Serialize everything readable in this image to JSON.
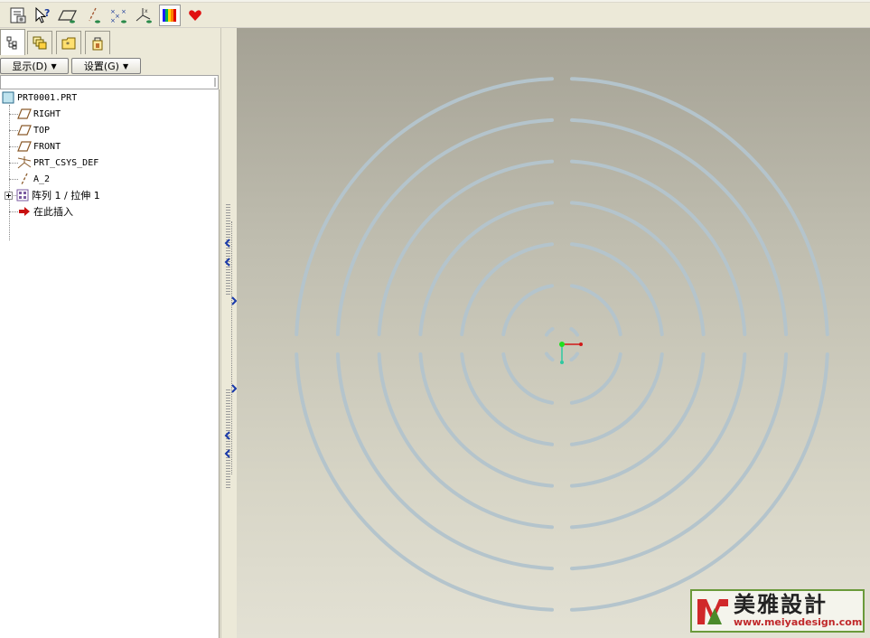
{
  "toolbar": {
    "icons": [
      "regenerate-display-icon",
      "query-select-icon",
      "datum-planes-icon",
      "datum-axes-icon",
      "datum-points-icon",
      "coordinate-systems-icon",
      "color-appearance-icon",
      "favorite-heart-icon"
    ]
  },
  "left_panel": {
    "tabs": [
      "model-tree-tab",
      "layer-tree-tab",
      "folder-browser-tab",
      "connections-tab"
    ],
    "show_menu": "显示(D)",
    "settings_menu": "设置(G)"
  },
  "tree": {
    "root": "PRT0001.PRT",
    "items": [
      {
        "label": "RIGHT",
        "icon": "datum-plane-icon"
      },
      {
        "label": "TOP",
        "icon": "datum-plane-icon"
      },
      {
        "label": "FRONT",
        "icon": "datum-plane-icon"
      },
      {
        "label": "PRT_CSYS_DEF",
        "icon": "coordinate-system-icon"
      },
      {
        "label": "A_2",
        "icon": "datum-axis-icon"
      },
      {
        "label": "阵列 1 / 拉伸 1",
        "icon": "pattern-icon"
      },
      {
        "label": "在此插入",
        "icon": "insert-here-arrow-icon"
      }
    ]
  },
  "viewport": {
    "ring_color": "#b4c4cc",
    "ring_count": 7
  },
  "watermark": {
    "title": "美雅設計",
    "url": "www.meiyadesign.com"
  },
  "colors": {
    "background": "#ece9d8",
    "viewport_top": "#a4a194",
    "viewport_bottom": "#e3e1d4",
    "watermark_border": "#6a9a3a",
    "watermark_url": "#c0282a"
  }
}
